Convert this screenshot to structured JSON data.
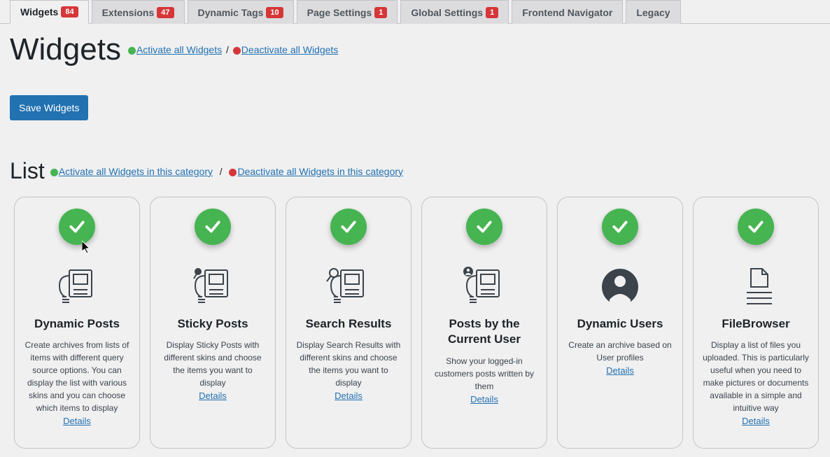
{
  "tabs": [
    {
      "label": "Widgets",
      "badge": "84",
      "active": true
    },
    {
      "label": "Extensions",
      "badge": "47",
      "active": false
    },
    {
      "label": "Dynamic Tags",
      "badge": "10",
      "active": false
    },
    {
      "label": "Page Settings",
      "badge": "1",
      "active": false
    },
    {
      "label": "Global Settings",
      "badge": "1",
      "active": false
    },
    {
      "label": "Frontend Navigator",
      "badge": null,
      "active": false
    },
    {
      "label": "Legacy",
      "badge": null,
      "active": false
    }
  ],
  "page": {
    "title": "Widgets",
    "activate_all": "Activate all Widgets",
    "deactivate_all": "Deactivate all Widgets",
    "separator": "/",
    "save_button": "Save Widgets"
  },
  "section": {
    "title": "List",
    "activate_cat": "Activate all Widgets in this category",
    "deactivate_cat": "Deactivate all Widgets in this category",
    "separator": "/"
  },
  "details_label": "Details",
  "cards": [
    {
      "title": "Dynamic Posts",
      "desc": "Create archives from lists of items with different query source options. You can display the list with various skins and you can choose which items to display",
      "icon": "doc-stack"
    },
    {
      "title": "Sticky Posts",
      "desc": "Display Sticky Posts with different skins and choose the items you want to display",
      "icon": "pin-doc"
    },
    {
      "title": "Search Results",
      "desc": "Display Search Results with different skins and choose the items you want to display",
      "icon": "search-doc"
    },
    {
      "title": "Posts by the Current User",
      "desc": "Show your logged-in customers posts written by them",
      "icon": "user-doc"
    },
    {
      "title": "Dynamic Users",
      "desc": "Create an archive based on User profiles",
      "icon": "user-circle"
    },
    {
      "title": "FileBrowser",
      "desc": "Display a list of files you uploaded. This is particularly useful when you need to make pictures or documents available in a simple and intuitive way",
      "icon": "file-lines"
    }
  ]
}
